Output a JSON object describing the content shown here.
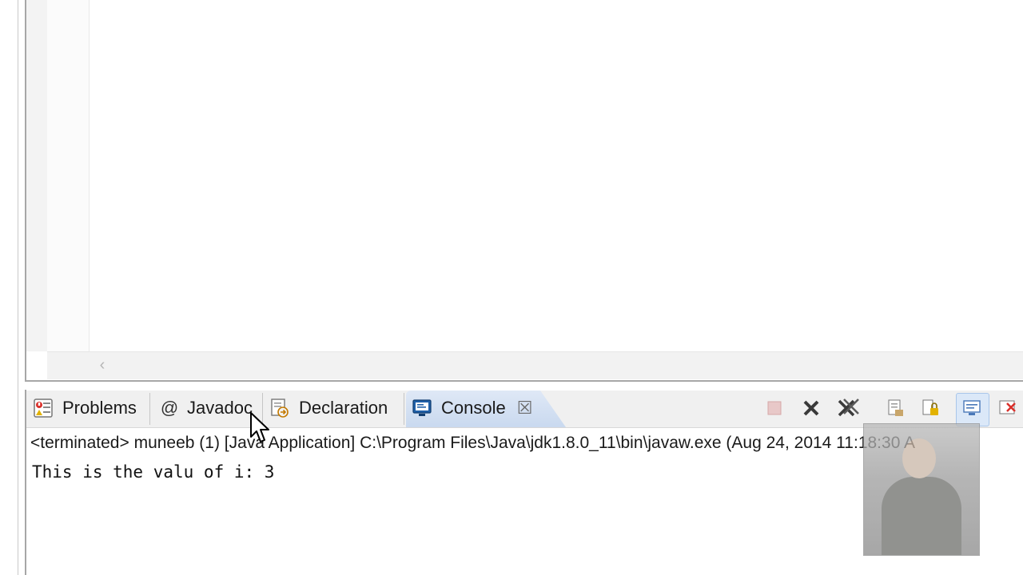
{
  "tabs": [
    {
      "label": "Problems",
      "icon": "problems-icon"
    },
    {
      "label": "Javadoc",
      "icon": "javadoc-at-icon",
      "icon_glyph": "@"
    },
    {
      "label": "Declaration",
      "icon": "declaration-icon"
    },
    {
      "label": "Console",
      "icon": "console-icon",
      "active": true
    }
  ],
  "toolbar_icons": [
    "terminate-icon",
    "remove-launch-icon",
    "remove-all-terminated-icon",
    "clear-console-icon",
    "scroll-lock-icon",
    "display-selected-console-icon",
    "pin-console-icon"
  ],
  "console": {
    "header": "<terminated> muneeb (1) [Java Application] C:\\Program Files\\Java\\jdk1.8.0_11\\bin\\javaw.exe (Aug 24, 2014 11:18:30 A",
    "output": "This is the valu of i: 3"
  },
  "colors": {
    "active_tab_top": "#dfe8f6",
    "active_tab_bottom": "#c9d9ef",
    "tab_strip": "#f0f0f0",
    "border": "#a7a7a7"
  }
}
